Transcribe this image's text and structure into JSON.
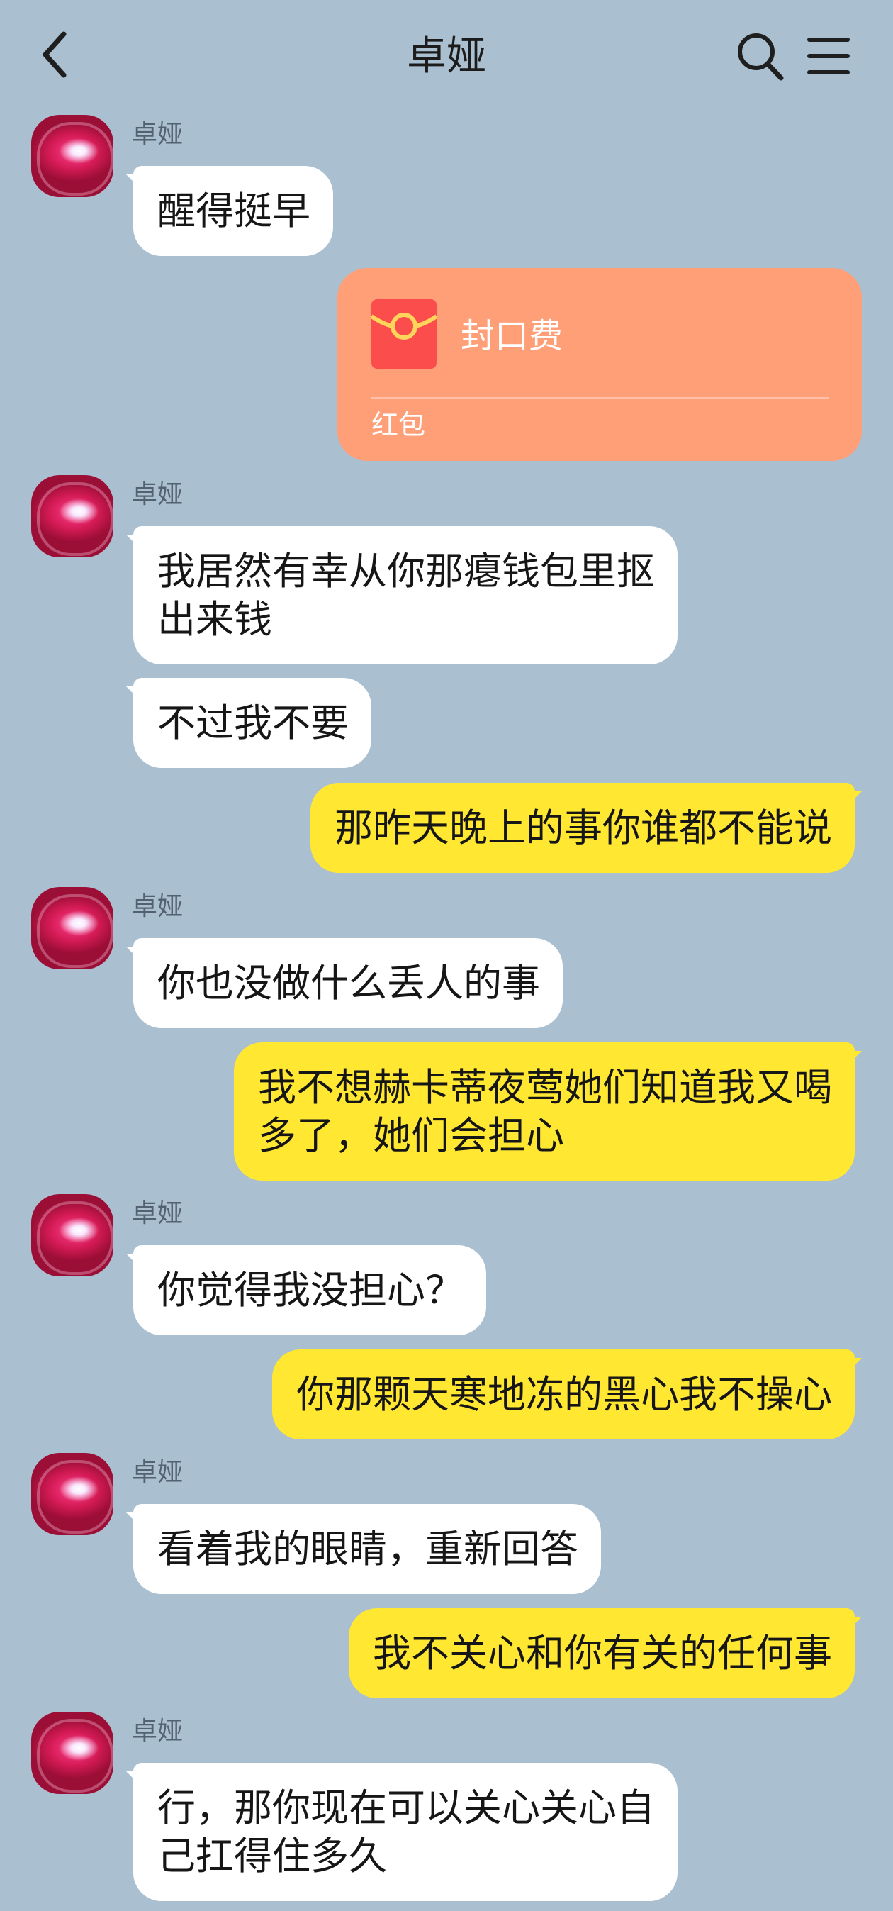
{
  "header": {
    "title": "卓娅",
    "icons": [
      "back-chevron-icon",
      "search-icon",
      "menu-icon"
    ]
  },
  "messages": [
    {
      "side": "in",
      "sender": "卓娅",
      "text": "醒得挺早"
    },
    {
      "side": "out",
      "type": "red_packet",
      "title": "封口费",
      "label": "红包"
    },
    {
      "side": "in",
      "sender": "卓娅",
      "text": "我居然有幸从你那瘪钱包里抠\n出来钱"
    },
    {
      "side": "in",
      "text": "不过我不要"
    },
    {
      "side": "out",
      "text": "那昨天晚上的事你谁都不能说"
    },
    {
      "side": "in",
      "sender": "卓娅",
      "text": "你也没做什么丢人的事"
    },
    {
      "side": "out",
      "text": "我不想赫卡蒂夜莺她们知道我又喝\n多了，她们会担心"
    },
    {
      "side": "in",
      "sender": "卓娅",
      "text": "你觉得我没担心？"
    },
    {
      "side": "out",
      "text": "你那颗天寒地冻的黑心我不操心"
    },
    {
      "side": "in",
      "sender": "卓娅",
      "text": "看着我的眼睛，重新回答"
    },
    {
      "side": "out",
      "text": "我不关心和你有关的任何事"
    },
    {
      "side": "in",
      "sender": "卓娅",
      "text": "行，那你现在可以关心关心自\n己扛得住多久"
    }
  ],
  "colors": {
    "background": "#aabfd0",
    "incoming_bubble": "#ffffff",
    "outgoing_bubble": "#ffe732",
    "red_packet": "#ff9f78",
    "red_packet_icon": "#fa4d4c"
  }
}
